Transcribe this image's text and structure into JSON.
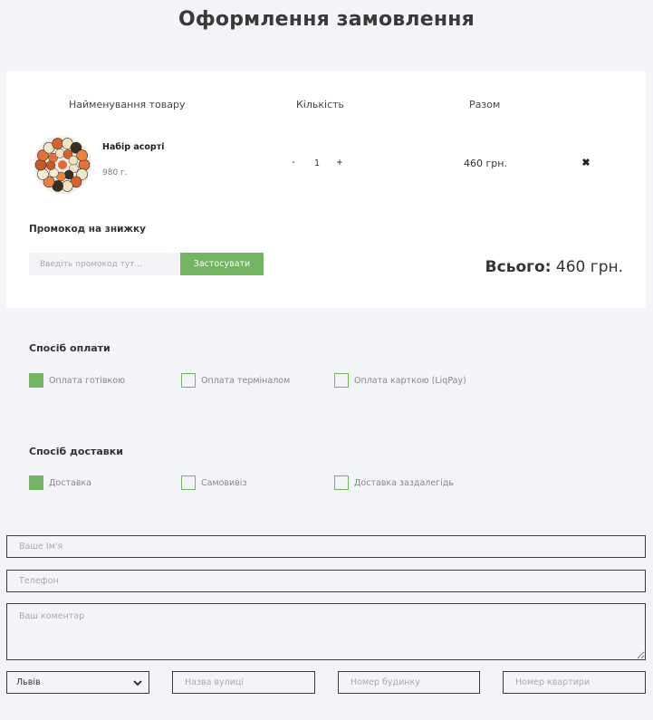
{
  "page": {
    "title": "Оформлення замовлення"
  },
  "cart": {
    "headers": {
      "name": "Найменування товару",
      "qty": "Кількість",
      "total": "Разом"
    },
    "item": {
      "name": "Набір асорті",
      "weight": "980 г.",
      "quantity": "1",
      "total": "460 грн.",
      "minus": "-",
      "plus": "+",
      "remove_icon": "close-icon"
    },
    "promo": {
      "label": "Промокод на знижку",
      "placeholder": "Введіть промокод тут...",
      "apply": "Застосувати"
    },
    "grand_total": {
      "label": "Всього:",
      "value": "460 грн."
    }
  },
  "payment": {
    "title": "Спосіб оплати",
    "options": [
      {
        "label": "Оплата готівкою",
        "selected": true
      },
      {
        "label": "Оплата терміналом",
        "selected": false
      },
      {
        "label": "Оплата карткою (LiqPay)",
        "selected": false
      }
    ]
  },
  "delivery": {
    "title": "Спосіб доставки",
    "options": [
      {
        "label": "Доставка",
        "selected": true
      },
      {
        "label": "Самовивіз",
        "selected": false
      },
      {
        "label": "Доставка заздалегідь",
        "selected": false
      }
    ]
  },
  "form": {
    "name_placeholder": "Ваше Ім'я",
    "phone_placeholder": "Телефон",
    "comment_placeholder": "Ваш коментар",
    "city": "Львів",
    "street_placeholder": "Назва вулиці",
    "house_placeholder": "Номер будинку",
    "apartment_placeholder": "Номер квартири"
  },
  "colors": {
    "accent": "#72b462",
    "background": "#f3f4f8",
    "card": "#ffffff"
  }
}
